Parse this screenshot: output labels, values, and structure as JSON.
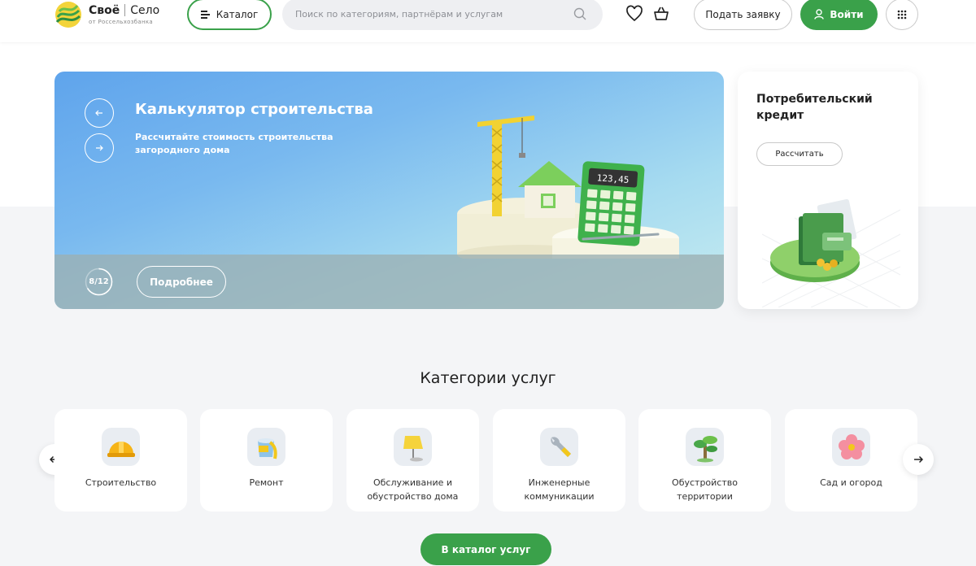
{
  "header": {
    "logo": {
      "name": "Своё",
      "product": "Село",
      "subtitle": "от Россельхозбанка"
    },
    "catalog_label": "Каталог",
    "search_placeholder": "Поиск по категориям, партнёрам и услугам",
    "submit_request_label": "Подать заявку",
    "login_label": "Войти",
    "icons": [
      "burger-icon",
      "search-icon",
      "heart-icon",
      "basket-icon",
      "user-icon",
      "apps-grid-icon"
    ]
  },
  "banner": {
    "title": "Калькулятор строительства",
    "description": "Рассчитайте стоимость строительства загородного дома",
    "counter": "8/12",
    "counter_progress": 0.667,
    "more_label": "Подробнее",
    "calculator_display": "123,45",
    "colors": {
      "accent": "#3aa14a"
    }
  },
  "credit": {
    "title": "Потребительский кредит",
    "button_label": "Рассчитать"
  },
  "categories": {
    "title": "Категории услуг",
    "items": [
      {
        "label": "Строительство",
        "icon": "hard-hat-icon"
      },
      {
        "label": "Ремонт",
        "icon": "paint-bucket-icon"
      },
      {
        "label": "Обслуживание и обустройство дома",
        "icon": "lamp-icon"
      },
      {
        "label": "Инженерные коммуникации",
        "icon": "wrench-icon"
      },
      {
        "label": "Обустройство территории",
        "icon": "tree-icon"
      },
      {
        "label": "Сад и огород",
        "icon": "flower-icon"
      }
    ],
    "catalog_button_label": "В каталог услуг"
  }
}
